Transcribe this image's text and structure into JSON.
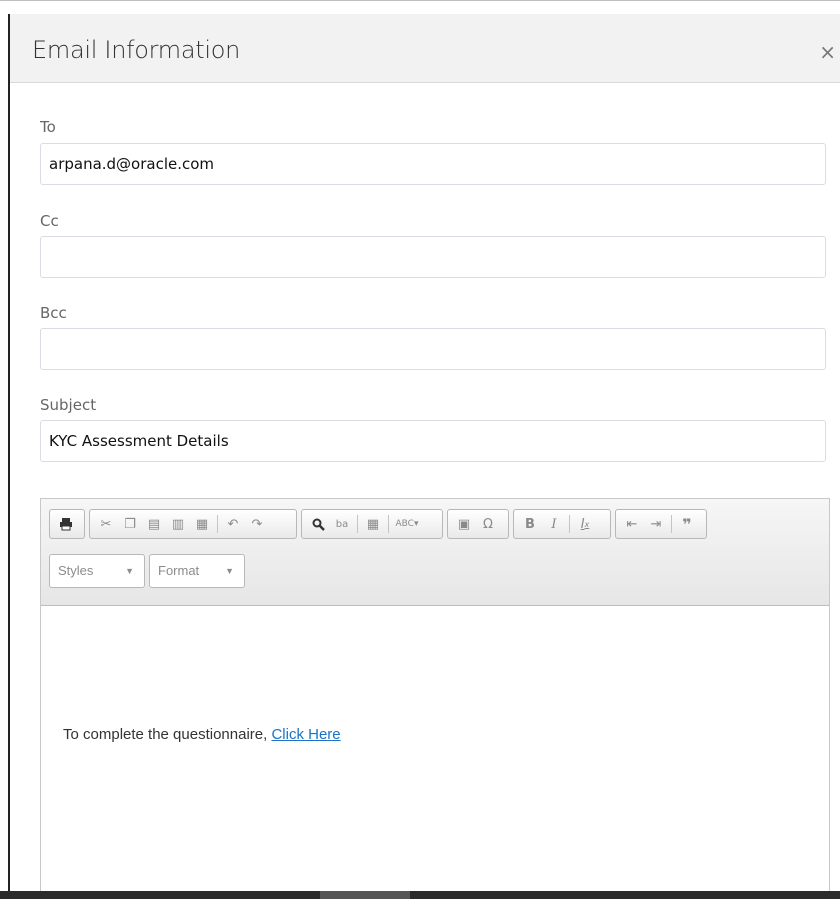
{
  "dialog": {
    "title": "Email Information",
    "close_glyph": "×"
  },
  "fields": {
    "to": {
      "label": "To",
      "value": "arpana.d@oracle.com"
    },
    "cc": {
      "label": "Cc",
      "value": ""
    },
    "bcc": {
      "label": "Bcc",
      "value": ""
    },
    "subject": {
      "label": "Subject",
      "value": "KYC Assessment Details"
    }
  },
  "toolbar": {
    "icons": [
      "print-icon",
      "cut-icon",
      "copy-icon",
      "paste-icon",
      "paste-text-icon",
      "paste-word-icon",
      "undo-icon",
      "redo-icon",
      "find-icon",
      "replace-icon",
      "select-all-icon",
      "spellcheck-icon",
      "image-icon",
      "special-char-icon",
      "bold-icon",
      "italic-icon",
      "remove-format-icon",
      "outdent-icon",
      "indent-icon",
      "blockquote-icon"
    ],
    "styles_label": "Styles",
    "format_label": "Format"
  },
  "editor": {
    "text": "To complete the questionnaire, ",
    "link_text": "Click Here"
  },
  "colors": {
    "header_bg": "#f2f2f2",
    "link": "#1a73c8",
    "border": "#d9dde3"
  }
}
